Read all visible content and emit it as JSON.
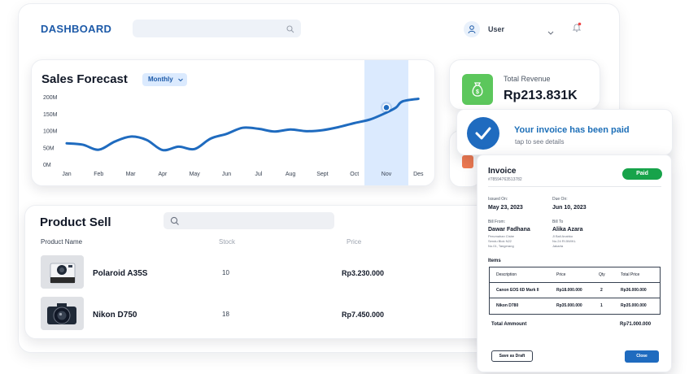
{
  "header": {
    "brand": "DASHBOARD",
    "user_name": "User",
    "icons": [
      "search-icon",
      "user-icon",
      "chevron-down-icon",
      "bell-icon"
    ],
    "notification_dot_color": "#ef4444"
  },
  "sales": {
    "title": "Sales Forecast",
    "period": "Monthly"
  },
  "chart_data": {
    "type": "line",
    "title": "Sales Forecast",
    "xlabel": "",
    "ylabel": "",
    "categories": [
      "Jan",
      "Feb",
      "Mar",
      "Apr",
      "May",
      "Jun",
      "Jul",
      "Aug",
      "Sept",
      "Oct",
      "Nov",
      "Des"
    ],
    "yticks": [
      "0M",
      "50M",
      "100M",
      "150M",
      "200M"
    ],
    "ylim": [
      0,
      200
    ],
    "x": [
      0,
      0.5,
      1,
      1.5,
      2,
      2.5,
      3,
      3.5,
      4,
      4.5,
      5,
      5.5,
      6,
      6.5,
      7,
      7.5,
      8,
      8.5,
      9,
      9.5,
      10,
      10.3,
      10.5,
      11
    ],
    "values": [
      62,
      58,
      43,
      67,
      82,
      72,
      42,
      52,
      45,
      76,
      90,
      108,
      105,
      97,
      103,
      98,
      101,
      110,
      122,
      133,
      153,
      168,
      186,
      194
    ],
    "highlight_category": "Nov",
    "highlight_value": 168,
    "line_color": "#1f6bbf",
    "highlight_color": "#dbeafe",
    "grid": false
  },
  "revenue": {
    "label": "Total Revenue",
    "value": "Rp213.831K",
    "icon_color": "#5cc75c"
  },
  "notification": {
    "title": "Your invoice has been paid",
    "subtitle": "tap to see details"
  },
  "product_sell": {
    "title": "Product Sell",
    "columns": [
      "Product Name",
      "Stock",
      "Price"
    ],
    "rows": [
      {
        "name": "Polaroid A35S",
        "stock": "10",
        "price": "Rp3.230.000",
        "image": "instant-camera"
      },
      {
        "name": "Nikon D750",
        "stock": "18",
        "price": "Rp7.450.000",
        "image": "dslr-camera"
      }
    ]
  },
  "invoice": {
    "title": "Invoice",
    "number": "#78594763513782",
    "status": "Paid",
    "issued_label": "Issued On:",
    "issued_value": "May 23, 2023",
    "due_label": "Due On:",
    "due_value": "Jun 10, 2023",
    "bill_from_label": "Bill From:",
    "bill_from_name": "Dawar Fadhana",
    "bill_from_addr": [
      "Perumahan Cisbe",
      "Sendu Blok N22",
      "No.01, Tangerang"
    ],
    "bill_to_label": "Bill To",
    "bill_to_name": "Alika Azara",
    "bill_to_addr": [
      "Jl Bali Anahko",
      "No.24 RI.5W/KL",
      "Jakarta"
    ],
    "items_label": "Items",
    "item_columns": [
      "Description",
      "Price",
      "Qty",
      "Total Price"
    ],
    "items": [
      {
        "description": "Canon EOS 6D Mark II",
        "price": "Rp18.000.000",
        "qty": "2",
        "total": "Rp36.000.000"
      },
      {
        "description": "Nikon D780",
        "price": "Rp35.000.000",
        "qty": "1",
        "total": "Rp35.000.000"
      }
    ],
    "total_label": "Total Ammount",
    "total_value": "Rp71.000.000",
    "save_draft": "Save as Draft",
    "close": "Close"
  }
}
